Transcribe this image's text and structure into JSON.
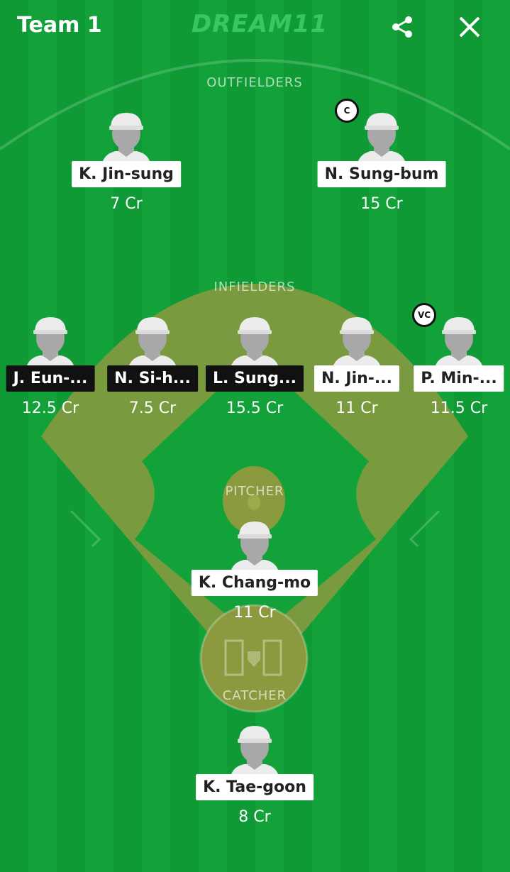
{
  "header": {
    "team_name": "Team 1",
    "logo_text": "DREAM11",
    "share_icon": "share-icon",
    "close_icon": "close-icon"
  },
  "sections": {
    "outfielders": "OUTFIELDERS",
    "infielders": "INFIELDERS",
    "pitcher": "PITCHER",
    "catcher": "CATCHER"
  },
  "players": {
    "of1": {
      "name": "K. Jin-sung",
      "credits": "7 Cr",
      "style": "light"
    },
    "of2": {
      "name": "N. Sung-bum",
      "credits": "15 Cr",
      "style": "light",
      "badge": "C"
    },
    "if1": {
      "name": "J. Eun-...",
      "credits": "12.5 Cr",
      "style": "dark"
    },
    "if2": {
      "name": "N. Si-h...",
      "credits": "7.5 Cr",
      "style": "dark"
    },
    "if3": {
      "name": "L. Sung...",
      "credits": "15.5 Cr",
      "style": "dark"
    },
    "if4": {
      "name": "N. Jin-...",
      "credits": "11 Cr",
      "style": "light"
    },
    "if5": {
      "name": "P. Min-...",
      "credits": "11.5 Cr",
      "style": "light",
      "badge": "VC"
    },
    "p1": {
      "name": "K. Chang-mo",
      "credits": "11 Cr",
      "style": "light"
    },
    "c1": {
      "name": "K. Tae-goon",
      "credits": "8 Cr",
      "style": "light"
    }
  },
  "colors": {
    "field_green": "#13a23a",
    "dirt": "#8c9a3f",
    "label_dark": "#111111",
    "label_light": "#ffffff"
  }
}
